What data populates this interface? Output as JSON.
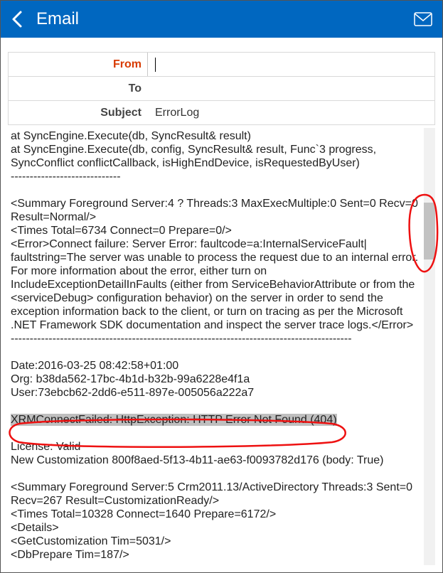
{
  "app_title": "Email",
  "fields": {
    "from_label": "From",
    "to_label": "To",
    "subject_label": "Subject",
    "from_value": "",
    "to_value": "",
    "subject_value": "ErrorLog"
  },
  "body": {
    "line1": "at SyncEngine.Execute(db, SyncResult& result)",
    "line2": "at SyncEngine.Execute(db, config, SyncResult& result, Func`3 progress, SyncConflict conflictCallback, isHighEndDevice, isRequestedByUser)",
    "sep1": "-----------------------------",
    "summary1": "<Summary Foreground Server:4 ? Threads:3 MaxExecMultiple:0 Sent=0 Recv=0 Result=Normal/>",
    "times1": "<Times Total=6734 Connect=0 Prepare=0/>",
    "error1": "<Error>Connect failure: Server Error: faultcode=a:InternalServiceFault| faultstring=The server was unable to process the request due to an internal error. For more information about the error, either turn on IncludeExceptionDetailInFaults (either from ServiceBehaviorAttribute or from the <serviceDebug> configuration behavior) on the server in order to send the exception information back to the client, or turn on tracing as per the Microsoft .NET Framework SDK documentation and inspect the server trace logs.</Error>",
    "sep2": "------------------------------------------------------------------------------------------",
    "date_line": "Date:2016-03-25 08:42:58+01:00",
    "org_line": "Org: b38da562-17bc-4b1d-b32b-99a6228e4f1a",
    "user_line": "User:73ebcb62-2dd6-e511-897e-005056a222a7",
    "xrm_fail": "XRMConnectFailed: HttpException: HTTP Error Not Found (404)",
    "license": "License: Valid",
    "newcust": "New Customization 800f8aed-5f13-4b11-ae63-f0093782d176 (body: True)",
    "summary2": "<Summary Foreground Server:5 Crm2011.13/ActiveDirectory Threads:3 Sent=0 Recv=267 Result=CustomizationReady/>",
    "times2": "<Times Total=10328 Connect=1640 Prepare=6172/>",
    "details": "<Details>",
    "getcust": "<GetCustomization Tim=5031/>",
    "dbprep": "<DbPrepare Tim=187/>"
  }
}
